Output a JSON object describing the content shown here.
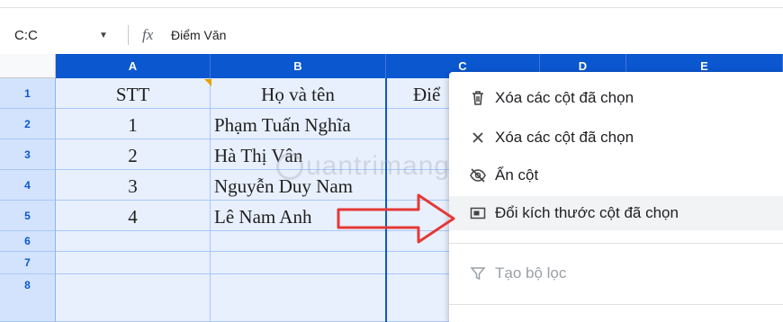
{
  "formula_bar": {
    "name_box": "C:C",
    "fx_symbol": "fx",
    "content": "Điểm Văn"
  },
  "columns": [
    "A",
    "B",
    "C",
    "D",
    "E"
  ],
  "rows": [
    "1",
    "2",
    "3",
    "4",
    "5",
    "6",
    "7",
    "8"
  ],
  "cells": {
    "A1": "STT",
    "B1": "Họ và tên",
    "C1": "Điể",
    "A2": "1",
    "B2": "Phạm Tuấn Nghĩa",
    "A3": "2",
    "B3": "Hà Thị Vân",
    "A4": "3",
    "B4": "Nguyễn Duy Nam",
    "A5": "4",
    "B5": "Lê Nam Anh"
  },
  "context_menu": {
    "items": [
      {
        "label": "Xóa các cột đã chọn",
        "icon": "trash-icon"
      },
      {
        "label": "Xóa các cột đã chọn",
        "icon": "close-icon"
      },
      {
        "label": "Ẩn cột",
        "icon": "eye-off-icon"
      },
      {
        "label": "Đổi kích thước cột đã chọn",
        "icon": "resize-icon",
        "highlighted": true
      },
      {
        "label": "Tạo bộ lọc",
        "icon": "filter-icon",
        "disabled": true
      }
    ]
  },
  "watermark": "uantrimang",
  "colors": {
    "accent": "#0b57d0",
    "selection_fill": "#e8f0fe",
    "arrow": "#e53935"
  }
}
